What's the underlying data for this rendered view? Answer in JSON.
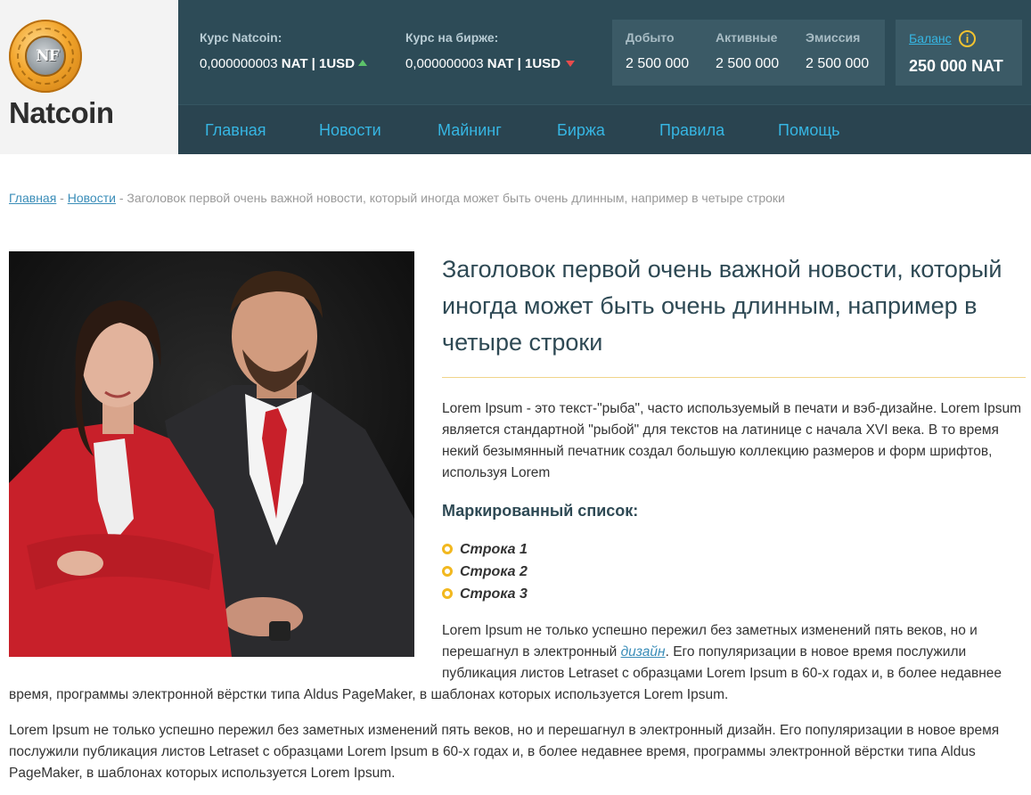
{
  "header": {
    "brand": "Natcoin",
    "coin_monogram": "NF",
    "coin_ring_text": "INVESTMENT CRYPTO CURRENCY",
    "rates": [
      {
        "label": "Курс Natcoin:",
        "amount": "0,000000003",
        "unit": "NAT | 1USD",
        "trend": "up"
      },
      {
        "label": "Курс на бирже:",
        "amount": "0,000000003",
        "unit": "NAT | 1USD",
        "trend": "down"
      }
    ],
    "stats": [
      {
        "label": "Добыто",
        "value": "2 500 000"
      },
      {
        "label": "Активные",
        "value": "2 500 000"
      },
      {
        "label": "Эмиссия",
        "value": "2 500 000"
      }
    ],
    "balance": {
      "label": "Баланс",
      "info_icon": "i",
      "value": "250 000 NAT"
    },
    "colors": {
      "topbar": "#2d4b57",
      "link": "#36b6e3",
      "accent": "#f2c230"
    }
  },
  "nav": {
    "items": [
      "Главная",
      "Новости",
      "Майнинг",
      "Биржа",
      "Правила",
      "Помощь"
    ]
  },
  "breadcrumb": {
    "home": "Главная",
    "news": "Новости",
    "separator": " - ",
    "current": "Заголовок первой очень важной новости, который иногда может быть очень длинным, например в четыре строки"
  },
  "article": {
    "title": "Заголовок первой очень важной новости, который иногда может быть очень длинным, например в четыре строки",
    "p1": "Lorem Ipsum - это текст-\"рыба\", часто используемый в печати и вэб-дизайне. Lorem Ipsum является стандартной \"рыбой\" для текстов на латинице с начала XVI века. В то время некий безымянный печатник создал большую коллекцию размеров и форм шрифтов, используя Lorem",
    "list_heading": "Маркированный список:",
    "list_items": [
      "Строка 1",
      "Строка 2",
      "Строка 3"
    ],
    "p2_before_link": "Lorem Ipsum не только успешно пережил без заметных изменений пять веков, но и перешагнул в электронный ",
    "p2_link": "дизайн",
    "p2_after_link": ". Его популяризации в новое время послужили публикация листов Letraset с образцами Lorem Ipsum в 60-х годах и, в более недавнее",
    "p2_continued": "время, программы электронной вёрстки типа Aldus PageMaker, в шаблонах которых используется Lorem Ipsum.",
    "p3": "Lorem Ipsum не только успешно пережил без заметных изменений пять веков, но и перешагнул в электронный дизайн. Его популяризации в новое время послужили публикация листов Letraset с образцами Lorem Ipsum в 60-х годах и, в более недавнее время, программы электронной вёрстки типа Aldus PageMaker, в шаблонах которых используется Lorem Ipsum."
  }
}
